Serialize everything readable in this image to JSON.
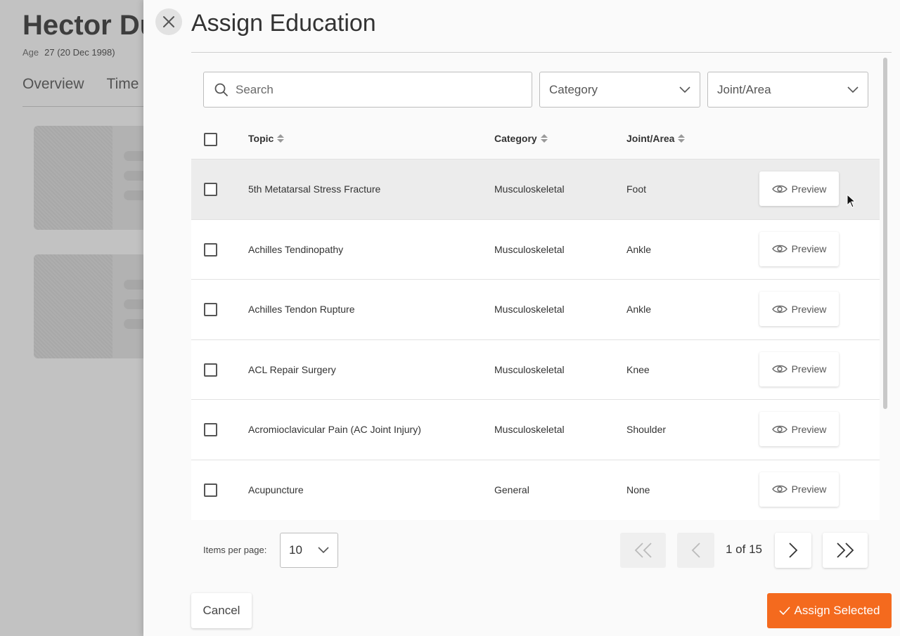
{
  "background": {
    "patient_name": "Hector Du",
    "age_label": "Age",
    "age_value": "27 (20 Dec 1998)",
    "tabs": [
      "Overview",
      "Time"
    ]
  },
  "modal": {
    "title": "Assign Education",
    "search_placeholder": "Search",
    "filters": {
      "category_label": "Category",
      "joint_label": "Joint/Area"
    },
    "columns": {
      "topic": "Topic",
      "category": "Category",
      "joint": "Joint/Area"
    },
    "rows": [
      {
        "topic": "5th Metatarsal Stress Fracture",
        "category": "Musculoskeletal",
        "joint": "Foot",
        "preview": "Preview"
      },
      {
        "topic": "Achilles Tendinopathy",
        "category": "Musculoskeletal",
        "joint": "Ankle",
        "preview": "Preview"
      },
      {
        "topic": "Achilles Tendon Rupture",
        "category": "Musculoskeletal",
        "joint": "Ankle",
        "preview": "Preview"
      },
      {
        "topic": "ACL Repair Surgery",
        "category": "Musculoskeletal",
        "joint": "Knee",
        "preview": "Preview"
      },
      {
        "topic": "Acromioclavicular Pain (AC Joint Injury)",
        "category": "Musculoskeletal",
        "joint": "Shoulder",
        "preview": "Preview"
      },
      {
        "topic": "Acupuncture",
        "category": "General",
        "joint": "None",
        "preview": "Preview"
      }
    ],
    "pagination": {
      "items_per_page_label": "Items per page:",
      "items_per_page_value": "10",
      "page_info": "1 of 15"
    },
    "cancel_label": "Cancel",
    "assign_label": "Assign Selected"
  },
  "colors": {
    "accent": "#f46a1e"
  }
}
